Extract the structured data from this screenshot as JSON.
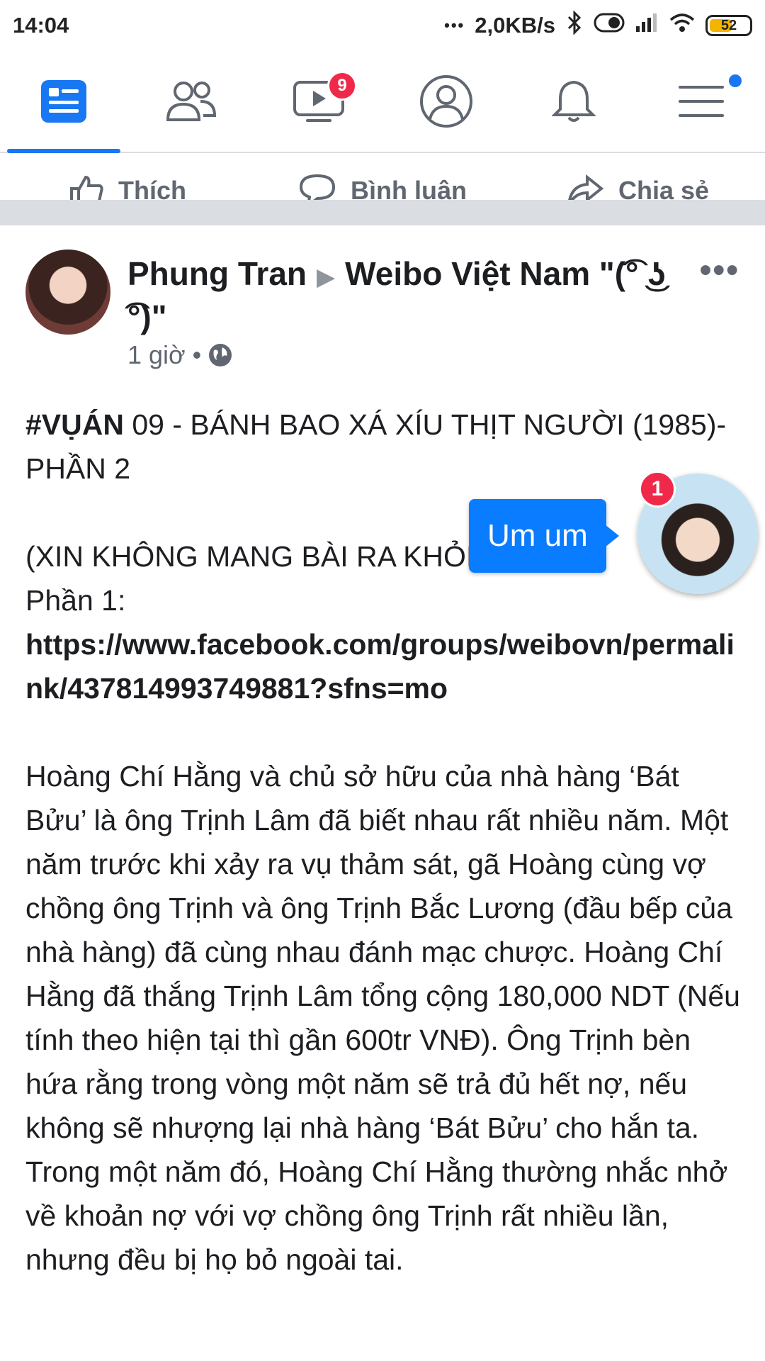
{
  "status_bar": {
    "time": "14:04",
    "dots": "•••",
    "speed": "2,0KB/s",
    "battery": "52"
  },
  "nav": {
    "video_badge": "9"
  },
  "prev_post_actions": {
    "like": "Thích",
    "comment": "Bình luận",
    "share": "Chia sẻ"
  },
  "post": {
    "author": "Phung Tran",
    "group": "Weibo Việt Nam \"(͡° ͜ʖ ͡°)\"",
    "time": "1 giờ",
    "more": "•••",
    "hashtag": "#VỤÁN",
    "title_rest": " 09 - BÁNH BAO XÁ XÍU THỊT NGƯỜI (1985)- PHẦN 2",
    "note": "(XIN KHÔNG MANG BÀI RA KHỎI GROUP)",
    "part1_label": "Phần 1:",
    "link": "https://www.facebook.com/groups/weibovn/permalink/437814993749881?sfns=mo",
    "body": "Hoàng Chí Hằng và chủ sở hữu của nhà hàng ‘Bát Bửu’ là ông Trịnh Lâm đã biết nhau rất nhiều năm. Một năm trước khi xảy ra vụ thảm sát, gã Hoàng cùng vợ chồng ông Trịnh và ông Trịnh Bắc Lương (đầu bếp của nhà hàng) đã cùng nhau đánh mạc chược. Hoàng Chí Hằng đã thắng Trịnh Lâm tổng cộng 180,000 NDT (Nếu tính theo hiện tại thì gần 600tr VNĐ). Ông Trịnh bèn hứa rằng trong vòng một năm sẽ trả đủ hết nợ, nếu không sẽ nhượng lại nhà hàng ‘Bát Bửu’ cho hắn ta. Trong một năm đó, Hoàng Chí Hằng thường nhắc nhở về khoản nợ với vợ chồng ông Trịnh rất nhiều lần, nhưng đều bị họ bỏ ngoài tai."
  },
  "chat_head": {
    "message": "Um um",
    "badge": "1"
  },
  "colors": {
    "accent": "#1877f2",
    "badge": "#f02849",
    "chat_bubble": "#0a7cff"
  }
}
